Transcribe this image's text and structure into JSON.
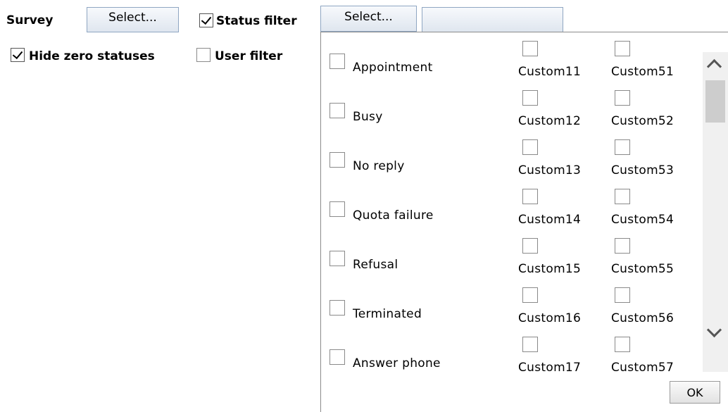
{
  "toolbar": {
    "survey_label": "Survey",
    "survey_select": "Select...",
    "status_filter_label": "Status filter",
    "status_filter_checked": true,
    "status_select": "Select...",
    "hide_zero_label": "Hide zero statuses",
    "hide_zero_checked": true,
    "user_filter_label": "User filter",
    "user_filter_checked": false
  },
  "status_popup": {
    "statuses": [
      {
        "label": "Appointment",
        "checked": false
      },
      {
        "label": "Busy",
        "checked": false
      },
      {
        "label": "No reply",
        "checked": false
      },
      {
        "label": "Quota failure",
        "checked": false
      },
      {
        "label": "Refusal",
        "checked": false
      },
      {
        "label": "Terminated",
        "checked": false
      },
      {
        "label": "Answer phone",
        "checked": false
      }
    ],
    "custom_col1": [
      "Custom11",
      "Custom12",
      "Custom13",
      "Custom14",
      "Custom15",
      "Custom16",
      "Custom17"
    ],
    "custom_col2": [
      "Custom51",
      "Custom52",
      "Custom53",
      "Custom54",
      "Custom55",
      "Custom56",
      "Custom57"
    ],
    "ok_label": "OK"
  }
}
